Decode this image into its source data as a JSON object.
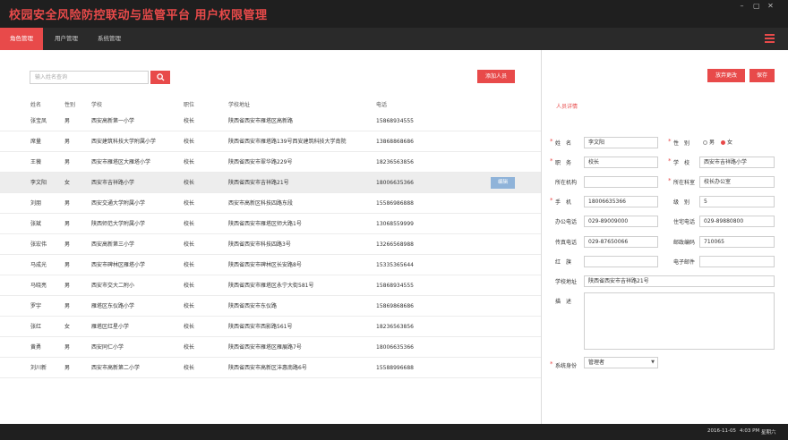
{
  "app": {
    "title": "校园安全风险防控联动与监管平台  用户权限管理",
    "window_controls": [
      "–",
      "▢",
      "✕"
    ]
  },
  "tabs": [
    {
      "label": "角色管理",
      "active": true
    },
    {
      "label": "用户管理",
      "active": false
    },
    {
      "label": "系统管理",
      "active": false
    }
  ],
  "toolbar": {
    "search_placeholder": "输入姓名查询",
    "add_button": "添加人员",
    "cancel_button": "放弃更改",
    "save_button": "保存"
  },
  "table": {
    "headers": [
      "姓名",
      "性别",
      "学校",
      "职位",
      "学校地址",
      "电话"
    ],
    "selected_index": 3,
    "edit_label": "编辑",
    "rows": [
      [
        "张宝凤",
        "男",
        "西安高新第一小学",
        "校长",
        "陕西省西安市雁塔区高新路",
        "15868934555"
      ],
      [
        "席量",
        "男",
        "西安建筑科技大学附属小学",
        "校长",
        "陕西省西安市雁塔路139号西安建筑科技大学南院",
        "13868868686"
      ],
      [
        "王薇",
        "男",
        "西安市雁塔区大雁塔小学",
        "校长",
        "陕西省西安市翠华路229号",
        "18236563856"
      ],
      [
        "李文阳",
        "女",
        "西安市吉祥路小学",
        "校长",
        "陕西省西安市吉祥路21号",
        "18006635366"
      ],
      [
        "刘朋",
        "男",
        "西安交通大学附属小学",
        "校长",
        "西安市高新区科技四路东段",
        "15586986888"
      ],
      [
        "张斌",
        "男",
        "陕西师范大学附属小学",
        "校长",
        "陕西省西安市雁塔区师大路1号",
        "13068559999"
      ],
      [
        "张宏伟",
        "男",
        "西安高新第三小学",
        "校长",
        "陕西省西安市科技四路3号",
        "13266568988"
      ],
      [
        "马成光",
        "男",
        "西安市碑林区雁塔小学",
        "校长",
        "陕西省西安市碑林区长安路8号",
        "15335365644"
      ],
      [
        "马晓亮",
        "男",
        "西安市交大二附小",
        "校长",
        "陕西省西安市雁塔区永宁大街581号",
        "15868934555"
      ],
      [
        "罗宇",
        "男",
        "雁塔区东仪路小学",
        "校长",
        "陕西省西安市东仪路",
        "15869868686"
      ],
      [
        "张红",
        "女",
        "雁塔区红星小学",
        "校长",
        "陕西省西安市西影路561号",
        "18236563856"
      ],
      [
        "黄勇",
        "男",
        "西安同仁小学",
        "校长",
        "陕西省西安市雁塔区雁展路7号",
        "18006635366"
      ],
      [
        "刘川新",
        "男",
        "西安市高新第二小学",
        "校长",
        "陕西省西安市高新区沣惠南路6号",
        "15588996688"
      ]
    ]
  },
  "form": {
    "section_title": "人员详情",
    "name_label": "姓　名",
    "name_value": "李文阳",
    "gender_label": "性　别",
    "gender_options": [
      "男",
      "女"
    ],
    "gender_selected": "女",
    "position_label": "职　务",
    "position_value": "校长",
    "school_label": "学　校",
    "school_value": "西安市吉祥路小学",
    "org_label": "所在机构",
    "org_value": "",
    "dept_label": "所在科室",
    "dept_value": "校长办公室",
    "mobile_label": "手　机",
    "mobile_value": "18006635366",
    "rank_label": "级　别",
    "rank_value": "5",
    "office_phone_label": "办公电话",
    "office_phone_value": "029-89009000",
    "home_phone_label": "住宅电话",
    "home_phone_value": "029-89880800",
    "fax_label": "传真电话",
    "fax_value": "029-87650066",
    "postcode_label": "邮政编码",
    "postcode_value": "710065",
    "redflag_label": "红　旗",
    "redflag_value": "",
    "email_label": "电子邮件",
    "email_value": "",
    "address_label": "学校地址",
    "address_value": "陕西省西安市吉祥路21号",
    "remark_label": "描　述",
    "remark_value": "",
    "identity_label": "系统身份",
    "identity_value": "管理者"
  },
  "status": {
    "date": "2016-11-05",
    "time": "4:03 PM",
    "weekday": "星期六"
  },
  "colors": {
    "accent": "#e84a4a",
    "topbar": "#1f1f1f",
    "tabbar": "#2a2a2a",
    "edit_button": "#8fb3d9"
  }
}
